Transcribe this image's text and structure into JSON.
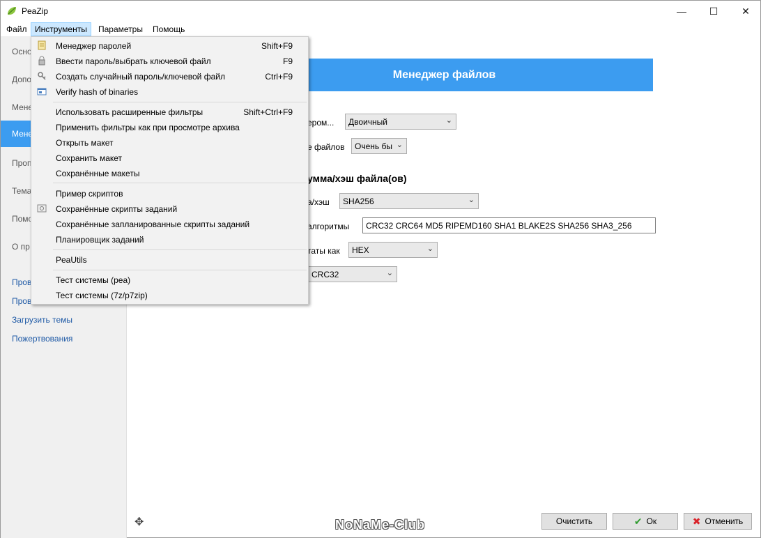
{
  "window": {
    "title": "PeaZip",
    "minimize_glyph": "—",
    "maximize_glyph": "☐",
    "close_glyph": "✕"
  },
  "menubar": [
    "Файл",
    "Инструменты",
    "Параметры",
    "Помощь"
  ],
  "sidebar": {
    "items": [
      "Осно",
      "Допо",
      "Мене",
      "Проп",
      "Тема",
      "Помо",
      "О пр"
    ],
    "selected": "Менед",
    "links": [
      "Пров",
      "Пров",
      "Загрузить темы",
      "Пожертвования"
    ]
  },
  "banner": {
    "title": "Менеджер файлов"
  },
  "form": {
    "row1_label": "ером...",
    "row1_value": "Двоичный",
    "row2_label": "е файлов",
    "row2_value": "Очень бы",
    "section_title": "умма/хэш файла(ов)",
    "row3_label": "а/хэш",
    "row3_value": "SHA256",
    "row4_label": "алгоритмы",
    "row4_value": "CRC32 CRC64 MD5 RIPEMD160 SHA1 BLAKE2S SHA256 SHA3_256",
    "row5_label": "таты как",
    "row5_value": "HEX",
    "row6_value": "CRC32",
    "combo_arrow": "⌄"
  },
  "footer": {
    "move_glyph": "✥",
    "watermark": "NoNaMe-Club",
    "clear_label": "Очистить",
    "ok_label": "Ок",
    "ok_glyph": "✔",
    "cancel_label": "Отменить",
    "cancel_glyph": "✖"
  },
  "dropdown": {
    "items": [
      {
        "label": "Менеджер паролей",
        "shortcut": "Shift+F9",
        "icon": "password-manager-icon"
      },
      {
        "label": "Ввести пароль/выбрать ключевой файл",
        "shortcut": "F9",
        "icon": "lock-icon"
      },
      {
        "label": "Создать случайный пароль/ключевой файл",
        "shortcut": "Ctrl+F9",
        "icon": "key-generate-icon"
      },
      {
        "label": "Verify hash of binaries",
        "shortcut": "",
        "icon": "verify-hash-icon"
      },
      {
        "label": "Использовать расширенные фильтры",
        "shortcut": "Shift+Ctrl+F9",
        "icon": ""
      },
      {
        "label": "Применить фильтры как при просмотре архива",
        "shortcut": "",
        "icon": ""
      },
      {
        "label": "Открыть макет",
        "shortcut": "",
        "icon": ""
      },
      {
        "label": "Сохранить макет",
        "shortcut": "",
        "icon": ""
      },
      {
        "label": "Сохранённые макеты",
        "shortcut": "",
        "icon": ""
      },
      {
        "label": "Пример скриптов",
        "shortcut": "",
        "icon": ""
      },
      {
        "label": "Сохранённые скрипты заданий",
        "shortcut": "",
        "icon": "scripts-icon"
      },
      {
        "label": "Сохранённые запланированные скрипты заданий",
        "shortcut": "",
        "icon": ""
      },
      {
        "label": "Планировщик заданий",
        "shortcut": "",
        "icon": ""
      },
      {
        "label": "PeaUtils",
        "shortcut": "",
        "icon": ""
      },
      {
        "label": "Тест системы (pea)",
        "shortcut": "",
        "icon": ""
      },
      {
        "label": "Тест системы (7z/p7zip)",
        "shortcut": "",
        "icon": ""
      }
    ]
  },
  "colors": {
    "accent": "#3c9cf0",
    "menu_highlight": "#cce8ff",
    "link": "#1f5aa6"
  }
}
